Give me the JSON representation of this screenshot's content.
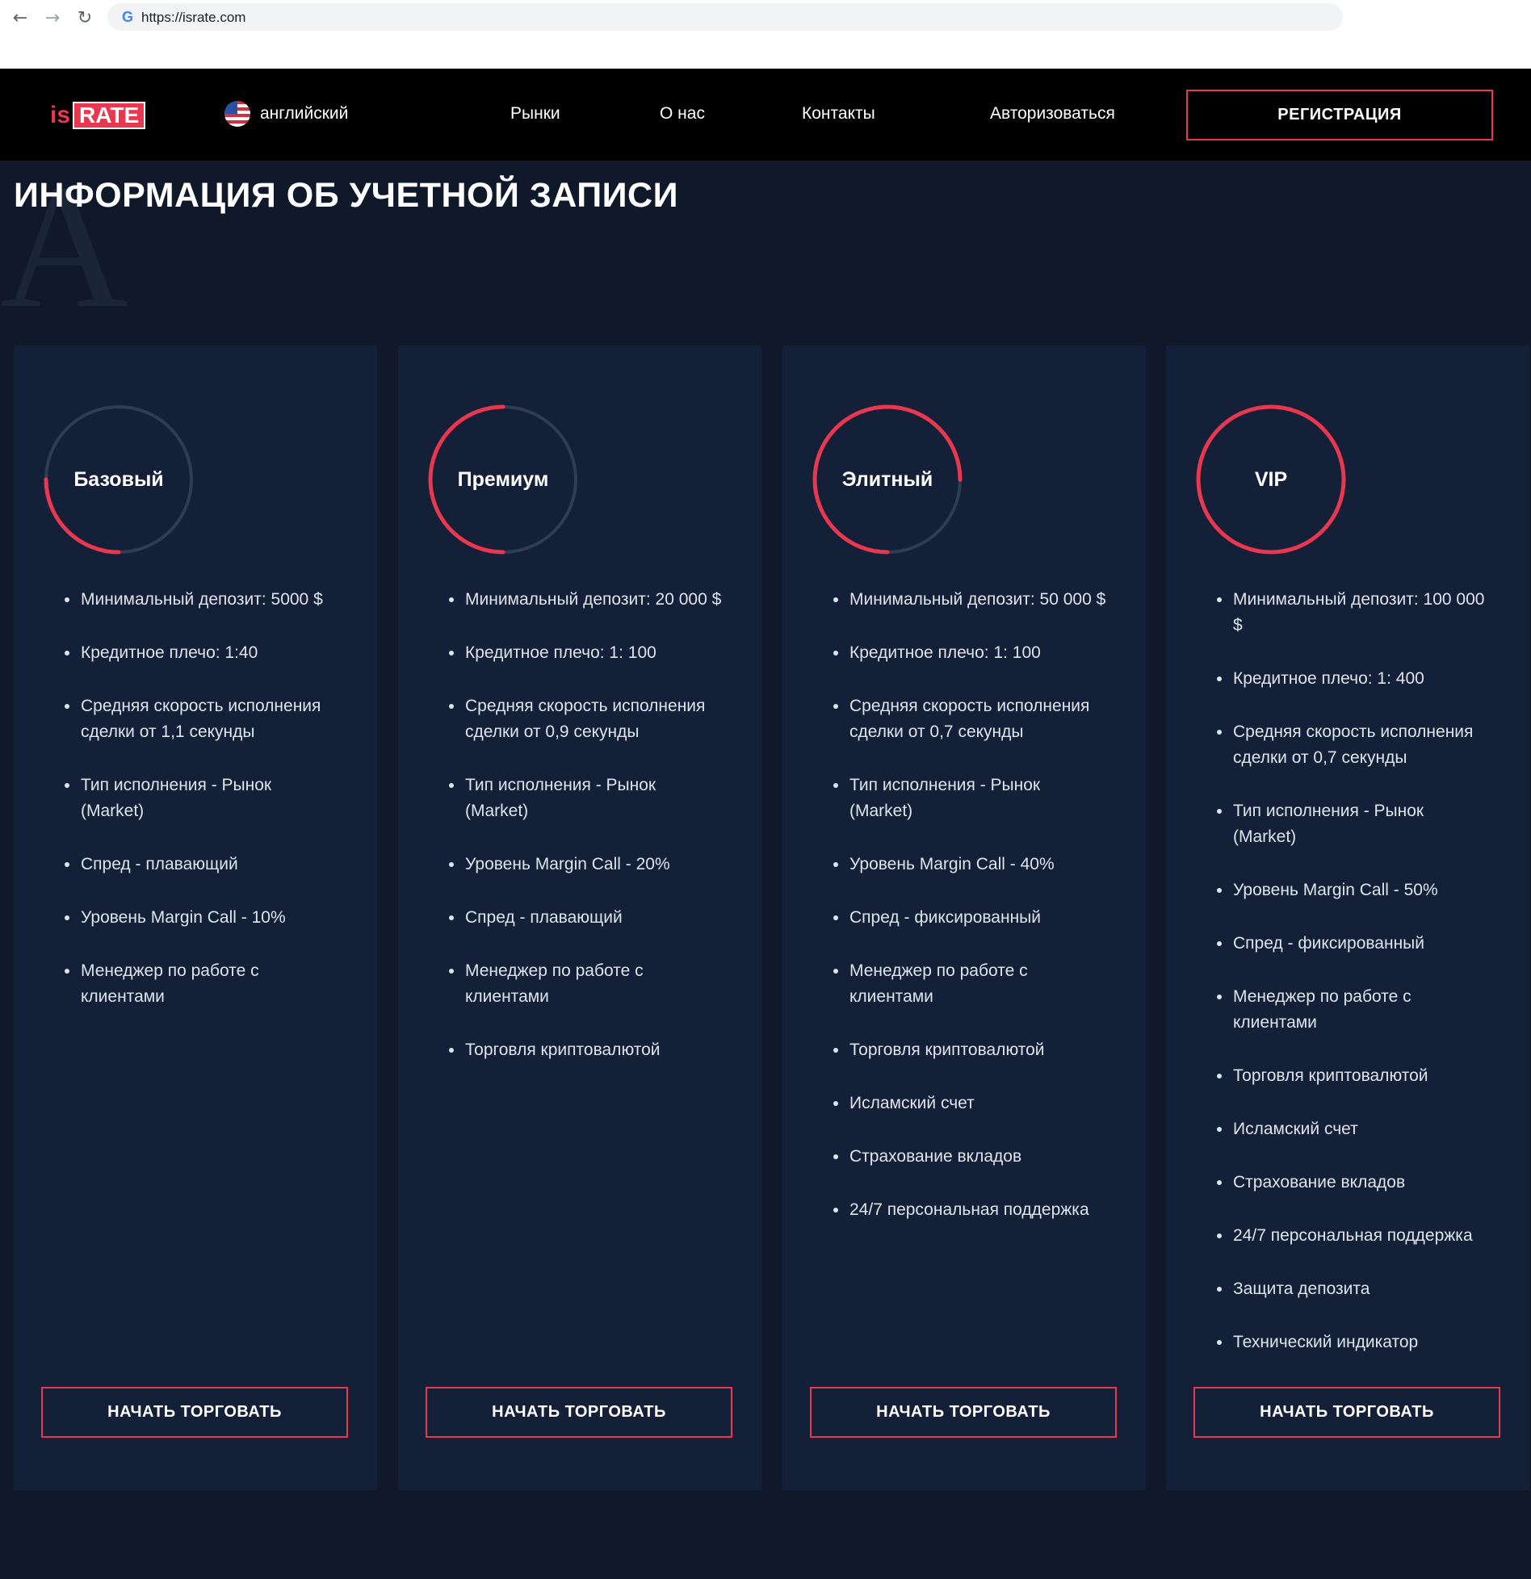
{
  "browser": {
    "url": "https://israte.com"
  },
  "header": {
    "logo_is": "is",
    "logo_rate": "RATE",
    "language": "английский",
    "nav": [
      "Рынки",
      "О нас",
      "Контакты",
      "Авторизоваться"
    ],
    "register": "РЕГИСТРАЦИЯ"
  },
  "section": {
    "title": "ИНФОРМАЦИЯ ОБ УЧЕТНОЙ ЗАПИСИ",
    "bg_letter": "A"
  },
  "colors": {
    "accent": "#e8374f",
    "card_bg": "#132038",
    "page_bg": "#0f192a",
    "ring_track": "#2f3d52"
  },
  "cards": [
    {
      "name": "Базовый",
      "ring_fill": 0.25,
      "features": [
        "Минимальный депозит: 5000 $",
        "Кредитное плечо: 1:40",
        "Средняя скорость исполнения сделки от 1,1 секунды",
        "Тип исполнения - Рынок (Market)",
        "Спред - плавающий",
        "Уровень Margin Call - 10%",
        "Менеджер по работе с клиентами"
      ],
      "button": "НАЧАТЬ ТОРГОВАТЬ"
    },
    {
      "name": "Премиум",
      "ring_fill": 0.5,
      "features": [
        "Минимальный депозит: 20 000 $",
        "Кредитное плечо: 1: 100",
        "Средняя скорость исполнения сделки от 0,9 секунды",
        "Тип исполнения - Рынок (Market)",
        "Уровень Margin Call - 20%",
        "Спред - плавающий",
        "Менеджер по работе с клиентами",
        "Торговля криптовалютой"
      ],
      "button": "НАЧАТЬ ТОРГОВАТЬ"
    },
    {
      "name": "Элитный",
      "ring_fill": 0.75,
      "features": [
        "Минимальный депозит: 50 000 $",
        "Кредитное плечо: 1: 100",
        "Средняя скорость исполнения сделки от 0,7 секунды",
        "Тип исполнения - Рынок (Market)",
        "Уровень Margin Call - 40%",
        "Спред - фиксированный",
        "Менеджер по работе с клиентами",
        "Торговля криптовалютой",
        "Исламский счет",
        "Страхование вкладов",
        "24/7 персональная поддержка"
      ],
      "button": "НАЧАТЬ ТОРГОВАТЬ"
    },
    {
      "name": "VIP",
      "ring_fill": 1.0,
      "features": [
        "Минимальный депозит: 100 000 $",
        "Кредитное плечо: 1: 400",
        "Средняя скорость исполнения сделки от 0,7 секунды",
        "Тип исполнения - Рынок (Market)",
        "Уровень Margin Call - 50%",
        "Спред - фиксированный",
        "Менеджер по работе с клиентами",
        "Торговля криптовалютой",
        "Исламский счет",
        "Страхование вкладов",
        "24/7 персональная поддержка",
        "Защита депозита",
        "Технический индикатор"
      ],
      "button": "НАЧАТЬ ТОРГОВАТЬ"
    }
  ]
}
